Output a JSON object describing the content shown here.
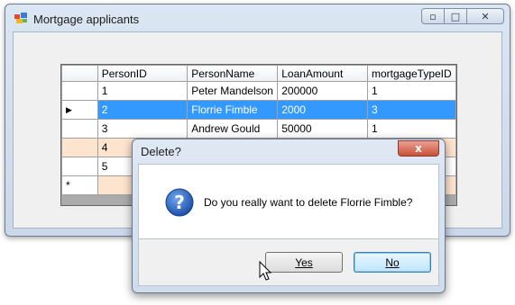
{
  "window": {
    "title": "Mortgage applicants"
  },
  "grid": {
    "columns": [
      "PersonID",
      "PersonName",
      "LoanAmount",
      "mortgageTypeID"
    ],
    "rows": [
      {
        "cells": [
          "1",
          "Peter Mandelson",
          "200000",
          "1"
        ],
        "marker": ""
      },
      {
        "cells": [
          "2",
          "Florrie Fimble",
          "2000",
          "3"
        ],
        "marker": "▶"
      },
      {
        "cells": [
          "3",
          "Andrew Gould",
          "50000",
          "1"
        ],
        "marker": ""
      },
      {
        "cells": [
          "4",
          "",
          "",
          ""
        ],
        "marker": ""
      },
      {
        "cells": [
          "5",
          "",
          "",
          ""
        ],
        "marker": ""
      },
      {
        "cells": [
          "",
          "",
          "",
          ""
        ],
        "marker": "*"
      }
    ]
  },
  "dialog": {
    "title": "Delete?",
    "close_label": "x",
    "message": "Do you really want to delete Florrie Fimble?",
    "yes_label": "Yes",
    "no_label": "No"
  },
  "colors": {
    "selection": "#3399ff",
    "new_row": "#fde4cf"
  },
  "icons": [
    "app-icon",
    "minimize-icon",
    "maximize-icon",
    "close-icon",
    "question-icon",
    "mouse-cursor"
  ]
}
